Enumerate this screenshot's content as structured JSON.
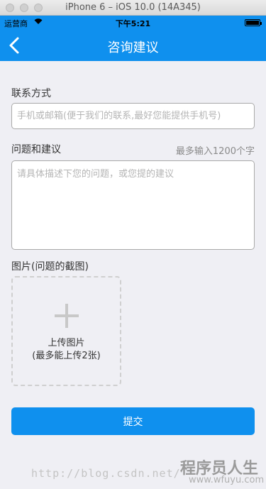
{
  "simulator": {
    "title": "iPhone 6 – iOS 10.0 (14A345)"
  },
  "status_bar": {
    "carrier": "运营商",
    "wifi_icon": "wifi-icon",
    "time": "下午5:21",
    "battery_icon": "battery-icon"
  },
  "nav": {
    "title": "咨询建议",
    "back_icon": "chevron-left-icon"
  },
  "contact": {
    "label": "联系方式",
    "placeholder": "手机或邮箱(便于我们的联系,最好您能提供手机号)",
    "value": ""
  },
  "advice": {
    "label": "问题和建议",
    "limit_hint": "最多输入1200个字",
    "placeholder": "请具体描述下您的问题，或您提的建议",
    "value": ""
  },
  "images": {
    "label": "图片(问题的截图)",
    "upload_label": "上传图片",
    "upload_sub": "(最多能上传2张)",
    "plus_icon": "plus-icon"
  },
  "submit": {
    "label": "提交"
  },
  "watermark": {
    "url": "http://blog.csdn.net/",
    "logo": "程序员人生",
    "site": "www.wfuyu.com"
  },
  "colors": {
    "primary": "#0f90ee",
    "background": "#efeff4"
  }
}
